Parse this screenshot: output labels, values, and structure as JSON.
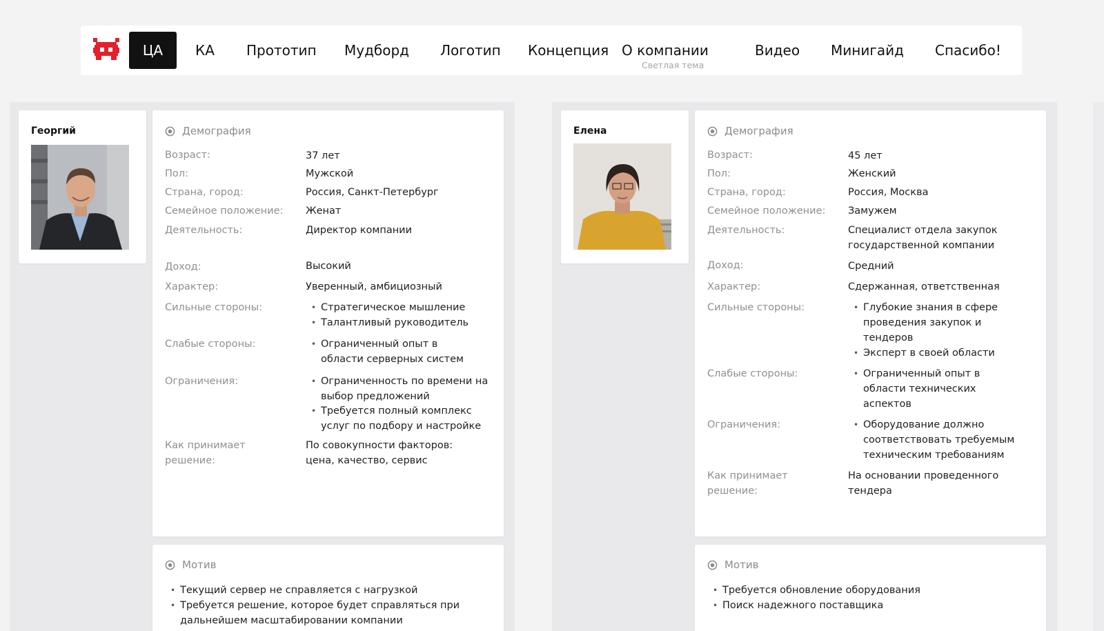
{
  "nav": {
    "items": [
      {
        "label": "ЦА"
      },
      {
        "label": "КА"
      },
      {
        "label": "Прототип"
      },
      {
        "label": "Мудборд"
      },
      {
        "label": "Логотип"
      },
      {
        "label": "Концепция"
      },
      {
        "label": "О компании",
        "sub": "Светлая тема"
      },
      {
        "label": "Видео"
      },
      {
        "label": "Минигайд"
      },
      {
        "label": "Спасибо!"
      }
    ]
  },
  "colors": {
    "accent": "#e3202b",
    "active_bg": "#111111",
    "panel_bg": "#e9e9eb"
  },
  "personas": [
    {
      "name": "Георгий",
      "demo_title": "Демография",
      "fields": [
        {
          "label": "Возраст:",
          "value": "37 лет"
        },
        {
          "label": "Пол:",
          "value": "Мужской"
        },
        {
          "label": "Страна, город:",
          "value": "Россия, Санкт-Петербург"
        },
        {
          "label": "Семейное положение:",
          "value": "Женат"
        },
        {
          "label": "Деятельность:",
          "value": "Директор компании"
        },
        {
          "label": "Доход:",
          "value": "Высокий"
        },
        {
          "label": "Характер:",
          "value": "Уверенный, амбициозный"
        },
        {
          "label": "Сильные стороны:",
          "items": [
            "Стратегическое мышление",
            "Талантливый руководитель"
          ]
        },
        {
          "label": "Слабые стороны:",
          "items": [
            "Ограниченный опыт в области серверных систем"
          ]
        },
        {
          "label": "Ограничения:",
          "items": [
            "Ограниченность по времени на выбор предложений",
            "Требуется полный комплекс услуг по подбору и настройке"
          ]
        },
        {
          "label": "Как принимает решение:",
          "value": "По совокупности факторов: цена, качество, сервис"
        }
      ],
      "motive_title": "Мотив",
      "motives": [
        "Текущий сервер не справляется с нагрузкой",
        "Требуется решение, которое будет справляться при дальнейшем масштабировании компании"
      ]
    },
    {
      "name": "Елена",
      "demo_title": "Демография",
      "fields": [
        {
          "label": "Возраст:",
          "value": "45 лет"
        },
        {
          "label": "Пол:",
          "value": "Женский"
        },
        {
          "label": "Страна, город:",
          "value": "Россия, Москва"
        },
        {
          "label": "Семейное положение:",
          "value": "Замужем"
        },
        {
          "label": "Деятельность:",
          "value": "Специалист отдела закупок государственной компании"
        },
        {
          "label": "Доход:",
          "value": "Средний"
        },
        {
          "label": "Характер:",
          "value": "Сдержанная, ответственная"
        },
        {
          "label": "Сильные стороны:",
          "items": [
            "Глубокие знания в сфере проведения закупок и тендеров",
            "Эксперт в своей области"
          ]
        },
        {
          "label": "Слабые стороны:",
          "items": [
            "Ограниченный опыт в области технических аспектов"
          ]
        },
        {
          "label": "Ограничения:",
          "items": [
            "Оборудование должно соответствовать требуемым техническим требованиям"
          ]
        },
        {
          "label": "Как принимает решение:",
          "value": "На основании проведенного тендера"
        }
      ],
      "motive_title": "Мотив",
      "motives": [
        "Требуется обновление оборудования",
        "Поиск надежного поставщика"
      ]
    }
  ]
}
